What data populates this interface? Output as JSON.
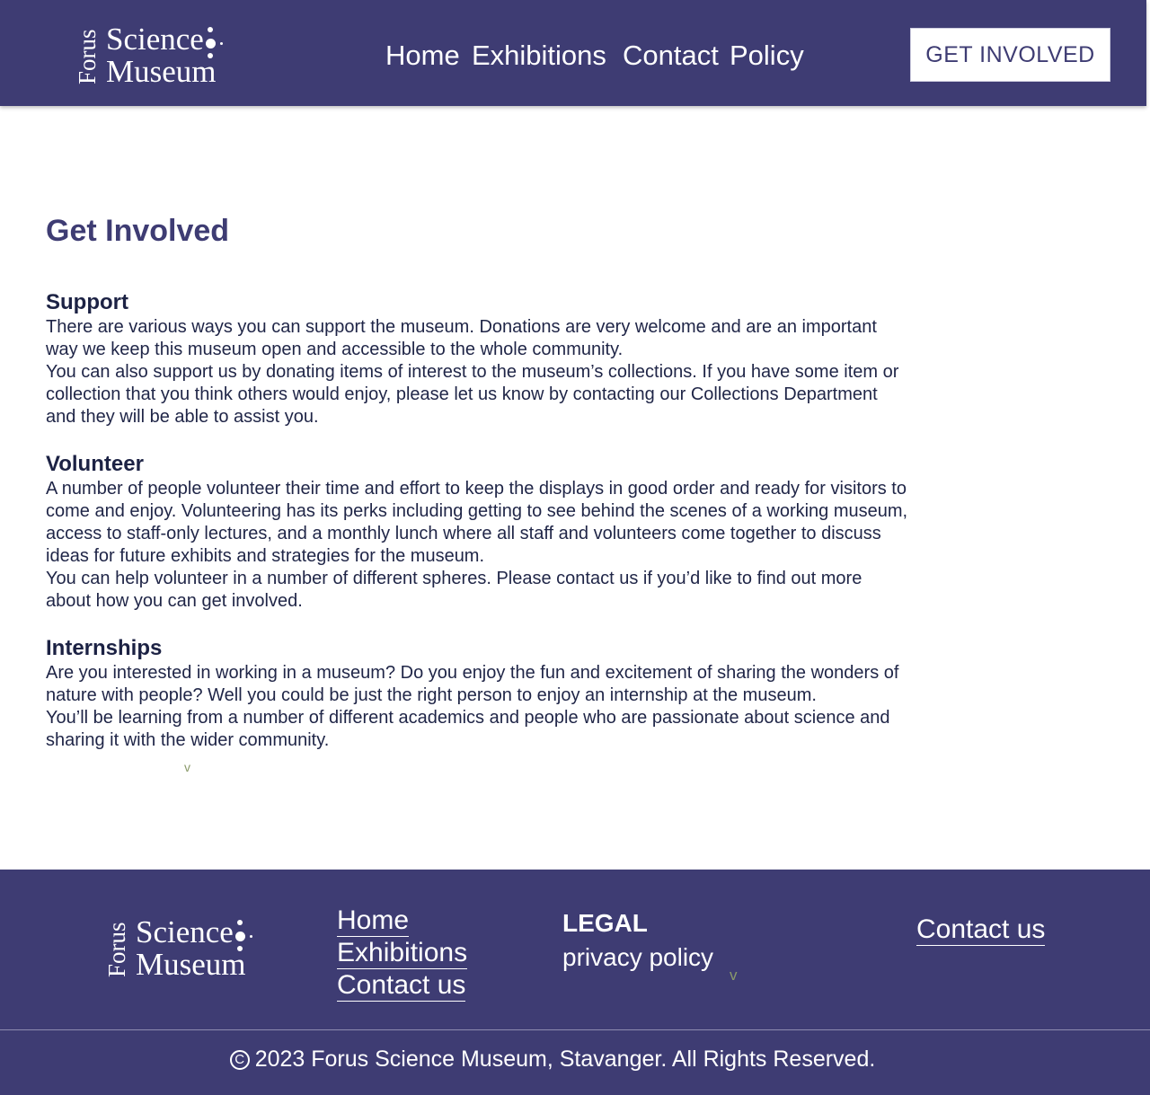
{
  "header": {
    "logo": {
      "forus": "Forus",
      "line1": "Science",
      "line2": "Museum"
    },
    "nav": [
      {
        "label": "Home"
      },
      {
        "label": "Exhibitions"
      },
      {
        "label": "Contact"
      },
      {
        "label": "Policy"
      }
    ],
    "cta_label": "GET INVOLVED"
  },
  "main": {
    "title": "Get Involved",
    "sections": [
      {
        "heading": "Support",
        "paragraphs": [
          "There are various ways you can support the museum. Donations are very welcome and are an important way we keep this museum open and accessible to the whole community.",
          "You can also support us by donating items of interest to the museum’s collections. If you have some item or collection that you think others would enjoy, please let us know by contacting our Collections Department and they will be able to assist you."
        ]
      },
      {
        "heading": "Volunteer",
        "paragraphs": [
          "A number of people volunteer their time and effort to keep the displays in good order and ready for visitors to come and enjoy. Volunteering has its perks including getting to see behind the scenes of a working museum, access to staff-only lectures, and a monthly lunch where all staff and volunteers come together to discuss ideas for future exhibits and strategies for the museum.",
          "You can help volunteer in a number of different spheres. Please contact us if you’d like to find out more about how you can get involved."
        ]
      },
      {
        "heading": "Internships",
        "paragraphs": [
          "Are you interested in working in a museum? Do you enjoy the fun and excitement of sharing the wonders of nature with people? Well you could be just the right person to enjoy an internship at the museum.",
          "You’ll be learning from a number of different academics and people who are passionate about science and sharing it with the wider community."
        ]
      }
    ],
    "stray_glyph": "v"
  },
  "footer": {
    "logo": {
      "forus": "Forus",
      "line1": "Science",
      "line2": "Museum"
    },
    "links": [
      {
        "label": "Home"
      },
      {
        "label": "Exhibitions"
      },
      {
        "label": "Contact us"
      }
    ],
    "legal_heading": "LEGAL",
    "privacy_label": "privacy policy",
    "contact_label": "Contact us",
    "stray_glyph": "v",
    "copyright_symbol": "C",
    "copyright_text": "2023 Forus Science Museum, Stavanger. All Rights Reserved."
  }
}
